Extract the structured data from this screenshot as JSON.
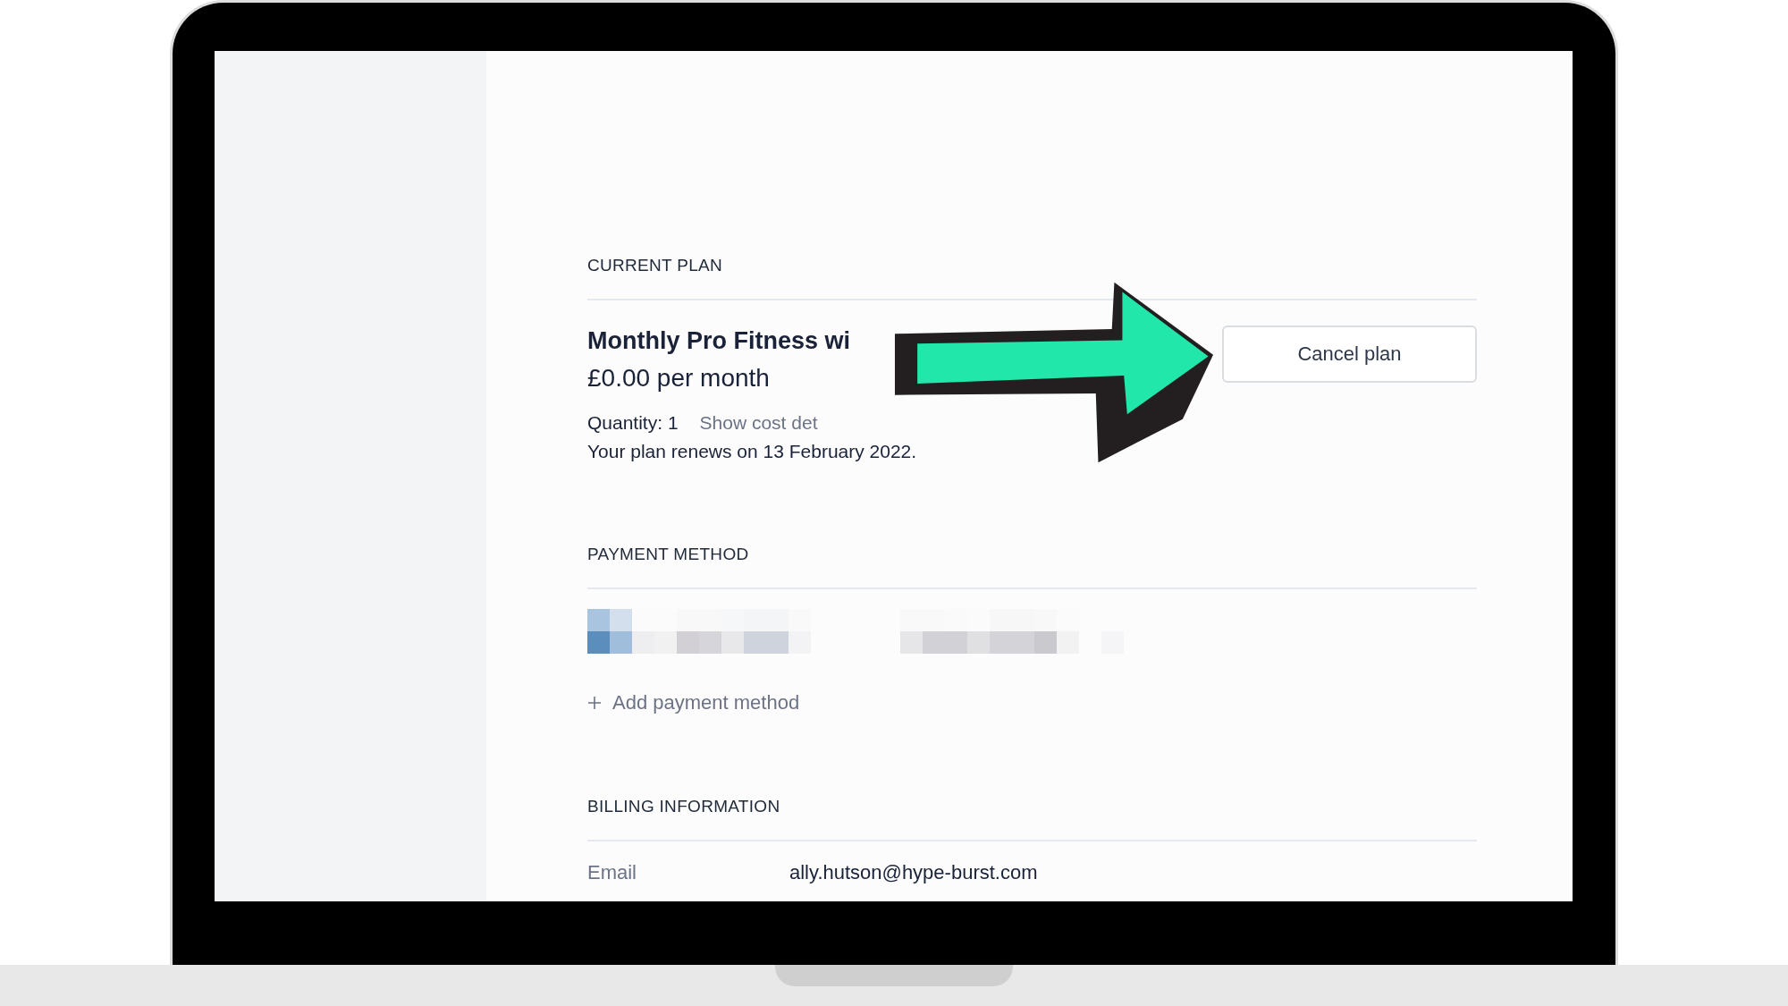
{
  "sections": [
    {
      "kind": "plan",
      "heading": "CURRENT PLAN",
      "plan_name": "Monthly Pro Fitness wi",
      "price": "£0.00 per month",
      "quantity": "Quantity: 1",
      "cost_link": "Show cost det",
      "renewal": "Your plan renews on 13 February 2022.",
      "button": "Cancel plan"
    },
    {
      "kind": "payment",
      "heading": "PAYMENT METHOD",
      "add_link": "Add payment method"
    },
    {
      "kind": "billing",
      "heading": "BILLING INFORMATION",
      "rows": [
        {
          "label": "Email",
          "value": "ally.hutson@hype-burst.com"
        }
      ]
    }
  ]
}
